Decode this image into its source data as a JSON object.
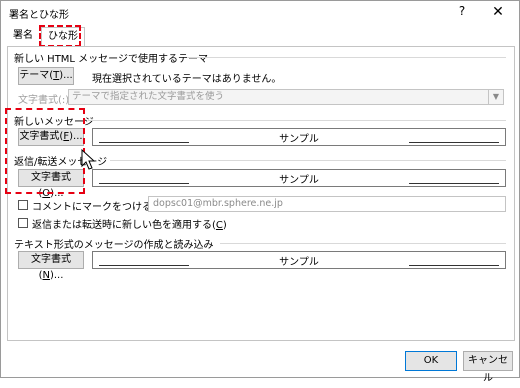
{
  "window": {
    "title": "署名とひな形",
    "help_glyph": "?",
    "close_glyph": "✕"
  },
  "tabs": [
    {
      "label": "署名",
      "active": false
    },
    {
      "label": "ひな形",
      "active": true
    }
  ],
  "theme_section": {
    "title": "新しい HTML メッセージで使用するテーマ",
    "theme_button_prefix": "テーマ(",
    "theme_button_mnemonic": "T",
    "theme_button_suffix": ")...",
    "status": "現在選択されているテーマはありません。",
    "font_label": "文字書式(:)",
    "font_select_value": "テーマで指定された文字書式を使う"
  },
  "new_message": {
    "title": "新しいメッセージ",
    "button_prefix": "文字書式(",
    "button_mnemonic": "F",
    "button_suffix": ")...",
    "sample": "サンプル"
  },
  "reply_forward": {
    "title": "返信/転送メッセージ",
    "button_prefix": "文字書式(",
    "button_mnemonic": "O",
    "button_suffix": ")...",
    "sample": "サンプル",
    "mark_comments_prefix": "コメントにマークをつける(",
    "mark_comments_mnemonic": "M",
    "mark_comments_suffix": "):",
    "mark_comments_value": "dopsc01@mbr.sphere.ne.jp",
    "pick_color_prefix": "返信または転送時に新しい色を適用する(",
    "pick_color_mnemonic": "C",
    "pick_color_suffix": ")"
  },
  "plain_text": {
    "title": "テキスト形式のメッセージの作成と読み込み",
    "button_prefix": "文字書式(",
    "button_mnemonic": "N",
    "button_suffix": ")...",
    "sample": "サンプル"
  },
  "footer": {
    "ok": "OK",
    "cancel": "キャンセル"
  },
  "colors": {
    "highlight": "#e60012",
    "ok_border": "#0078d7"
  }
}
